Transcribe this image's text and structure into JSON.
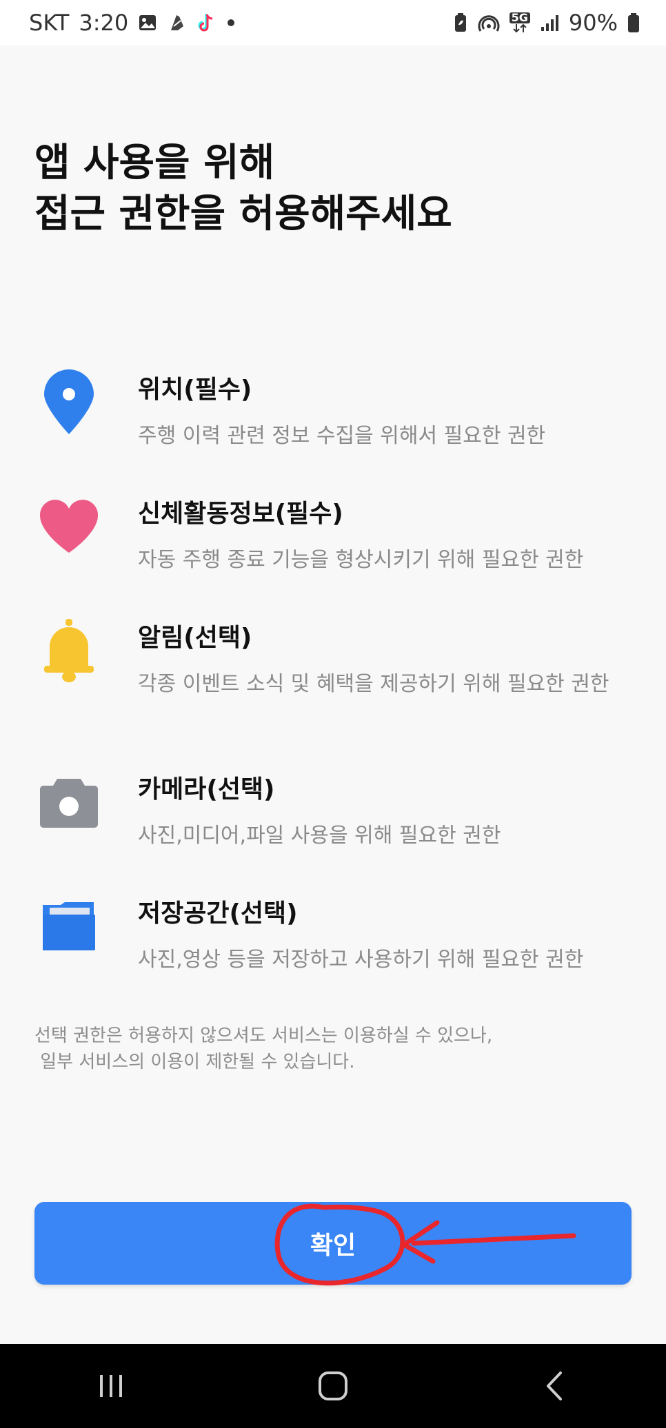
{
  "status_bar": {
    "carrier": "SKT",
    "time": "3:20",
    "network": "5G",
    "battery": "90%",
    "left_icons": [
      "gallery-icon",
      "app-icon",
      "tiktok-icon",
      "dot-icon"
    ],
    "right_icons": [
      "battery-saver-icon",
      "hotspot-icon",
      "5g-icon",
      "signal-icon",
      "battery-icon"
    ]
  },
  "title_line1": "앱 사용을 위해",
  "title_line2": "접근 권한을 허용해주세요",
  "permissions": [
    {
      "icon": "location-pin-icon",
      "color": "#2f80ed",
      "title": "위치(필수)",
      "desc": "주행 이력 관련 정보 수집을 위해서 필요한 권한"
    },
    {
      "icon": "heart-icon",
      "color": "#ec5a85",
      "title": "신체활동정보(필수)",
      "desc": "자동 주행 종료 기능을 형상시키기 위해 필요한 권한"
    },
    {
      "icon": "bell-icon",
      "color": "#f7c52f",
      "title": "알림(선택)",
      "desc": "각종 이벤트 소식 및 혜택을 제공하기 위해 필요한 권한"
    },
    {
      "icon": "camera-icon",
      "color": "#8e9097",
      "title": "카메라(선택)",
      "desc": "사진,미디어,파일 사용을 위해 필요한 권한"
    },
    {
      "icon": "folder-icon",
      "color": "#2f80ed",
      "title": "저장공간(선택)",
      "desc": "사진,영상 등을 저장하고 사용하기 위해 필요한 권한"
    }
  ],
  "notice_line1": "선택 권한은 허용하지 않으셔도 서비스는 이용하실 수 있으나,",
  "notice_line2": " 일부 서비스의 이용이 제한될 수 있습니다.",
  "confirm_label": "확인",
  "annotation_color": "#e8262b",
  "nav": [
    "recent-apps-icon",
    "home-icon",
    "back-icon"
  ]
}
